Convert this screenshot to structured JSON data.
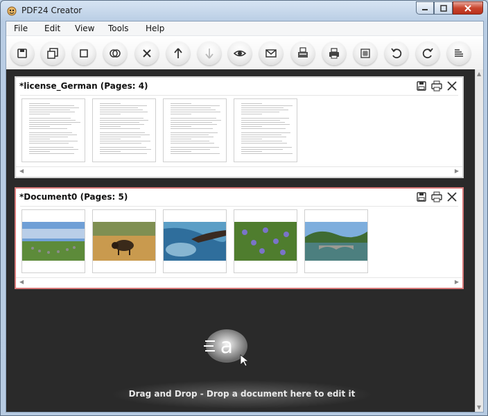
{
  "window": {
    "title": "PDF24 Creator"
  },
  "menu": [
    "File",
    "Edit",
    "View",
    "Tools",
    "Help"
  ],
  "toolbar": {
    "buttons": [
      "save-icon",
      "save-as-icon",
      "new-icon",
      "merge-icon",
      "delete-icon",
      "move-up-icon",
      "move-down-icon",
      "preview-icon",
      "email-icon",
      "fax-icon",
      "print-icon",
      "compress-icon",
      "rotate-left-icon",
      "rotate-right-icon",
      "align-icon"
    ]
  },
  "documents": [
    {
      "title": "*license_German (Pages: 4)",
      "pages": 4,
      "kind": "text"
    },
    {
      "title": "*Document0 (Pages: 5)",
      "pages": 5,
      "kind": "photos"
    }
  ],
  "dropzone": {
    "text": "Drag and Drop - Drop a document here to edit it"
  },
  "colors": {
    "workspace": "#2a2a2a",
    "active_border": "#d97a7a",
    "close_button": "#c9462f"
  }
}
